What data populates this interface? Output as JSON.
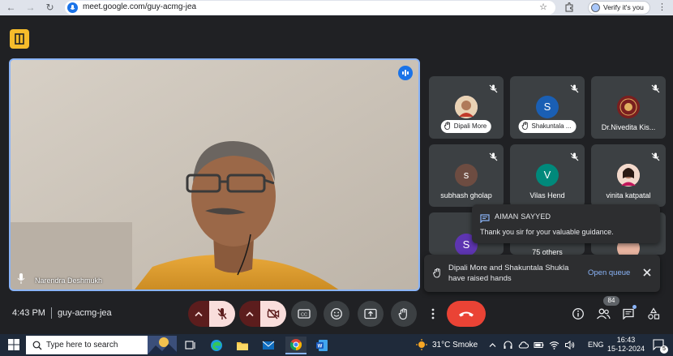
{
  "browser": {
    "url": "meet.google.com/guy-acmg-jea",
    "profile_label": "Verify it's you"
  },
  "main_speaker": {
    "name": "Narendra Deshmukh"
  },
  "participants": [
    {
      "name": "Dipali More",
      "initial": "",
      "hand_raised": true,
      "avatar_color": "#d9c6e8"
    },
    {
      "name": "Shakuntala ...",
      "initial": "S",
      "hand_raised": true,
      "avatar_color": "#1a5fb4"
    },
    {
      "name": "Dr.Nivedita Kis...",
      "initial": "",
      "hand_raised": false,
      "avatar_color": "#7a1f1f"
    },
    {
      "name": "subhash gholap",
      "initial": "s",
      "hand_raised": false,
      "avatar_color": "#6d4c41"
    },
    {
      "name": "Vilas Hend",
      "initial": "V",
      "hand_raised": false,
      "avatar_color": "#00897b"
    },
    {
      "name": "vinita katpatal",
      "initial": "",
      "hand_raised": false,
      "avatar_color": "#f4c6b0"
    },
    {
      "name": "",
      "initial": "S",
      "hand_raised": false,
      "avatar_color": "#5e35b1"
    },
    {
      "name": "75 others",
      "initial": "",
      "hand_raised": false,
      "avatar_color": "#3c4043"
    },
    {
      "name": "",
      "initial": "",
      "hand_raised": false,
      "avatar_color": "#e8b4a0"
    }
  ],
  "chat_toast": {
    "sender": "AIMAN SAYYED",
    "message": "Thank you sir for your valuable guidance."
  },
  "hands_toast": {
    "line1": "Dipali More and Shakuntala Shukla",
    "line2": "have raised hands",
    "action": "Open queue"
  },
  "meeting_bar": {
    "time": "4:43 PM",
    "separator": "|",
    "code": "guy-acmg-jea",
    "participant_count": "84"
  },
  "taskbar": {
    "search_placeholder": "Type here to search",
    "weather": "31°C  Smoke",
    "language": "ENG",
    "clock_time": "16:43",
    "clock_date": "15-12-2024",
    "notification_count": "5"
  },
  "colors": {
    "accent_blue": "#8ab4f8",
    "leave_red": "#ea4335",
    "bg_dark": "#202124",
    "tile_bg": "#3c4043"
  }
}
